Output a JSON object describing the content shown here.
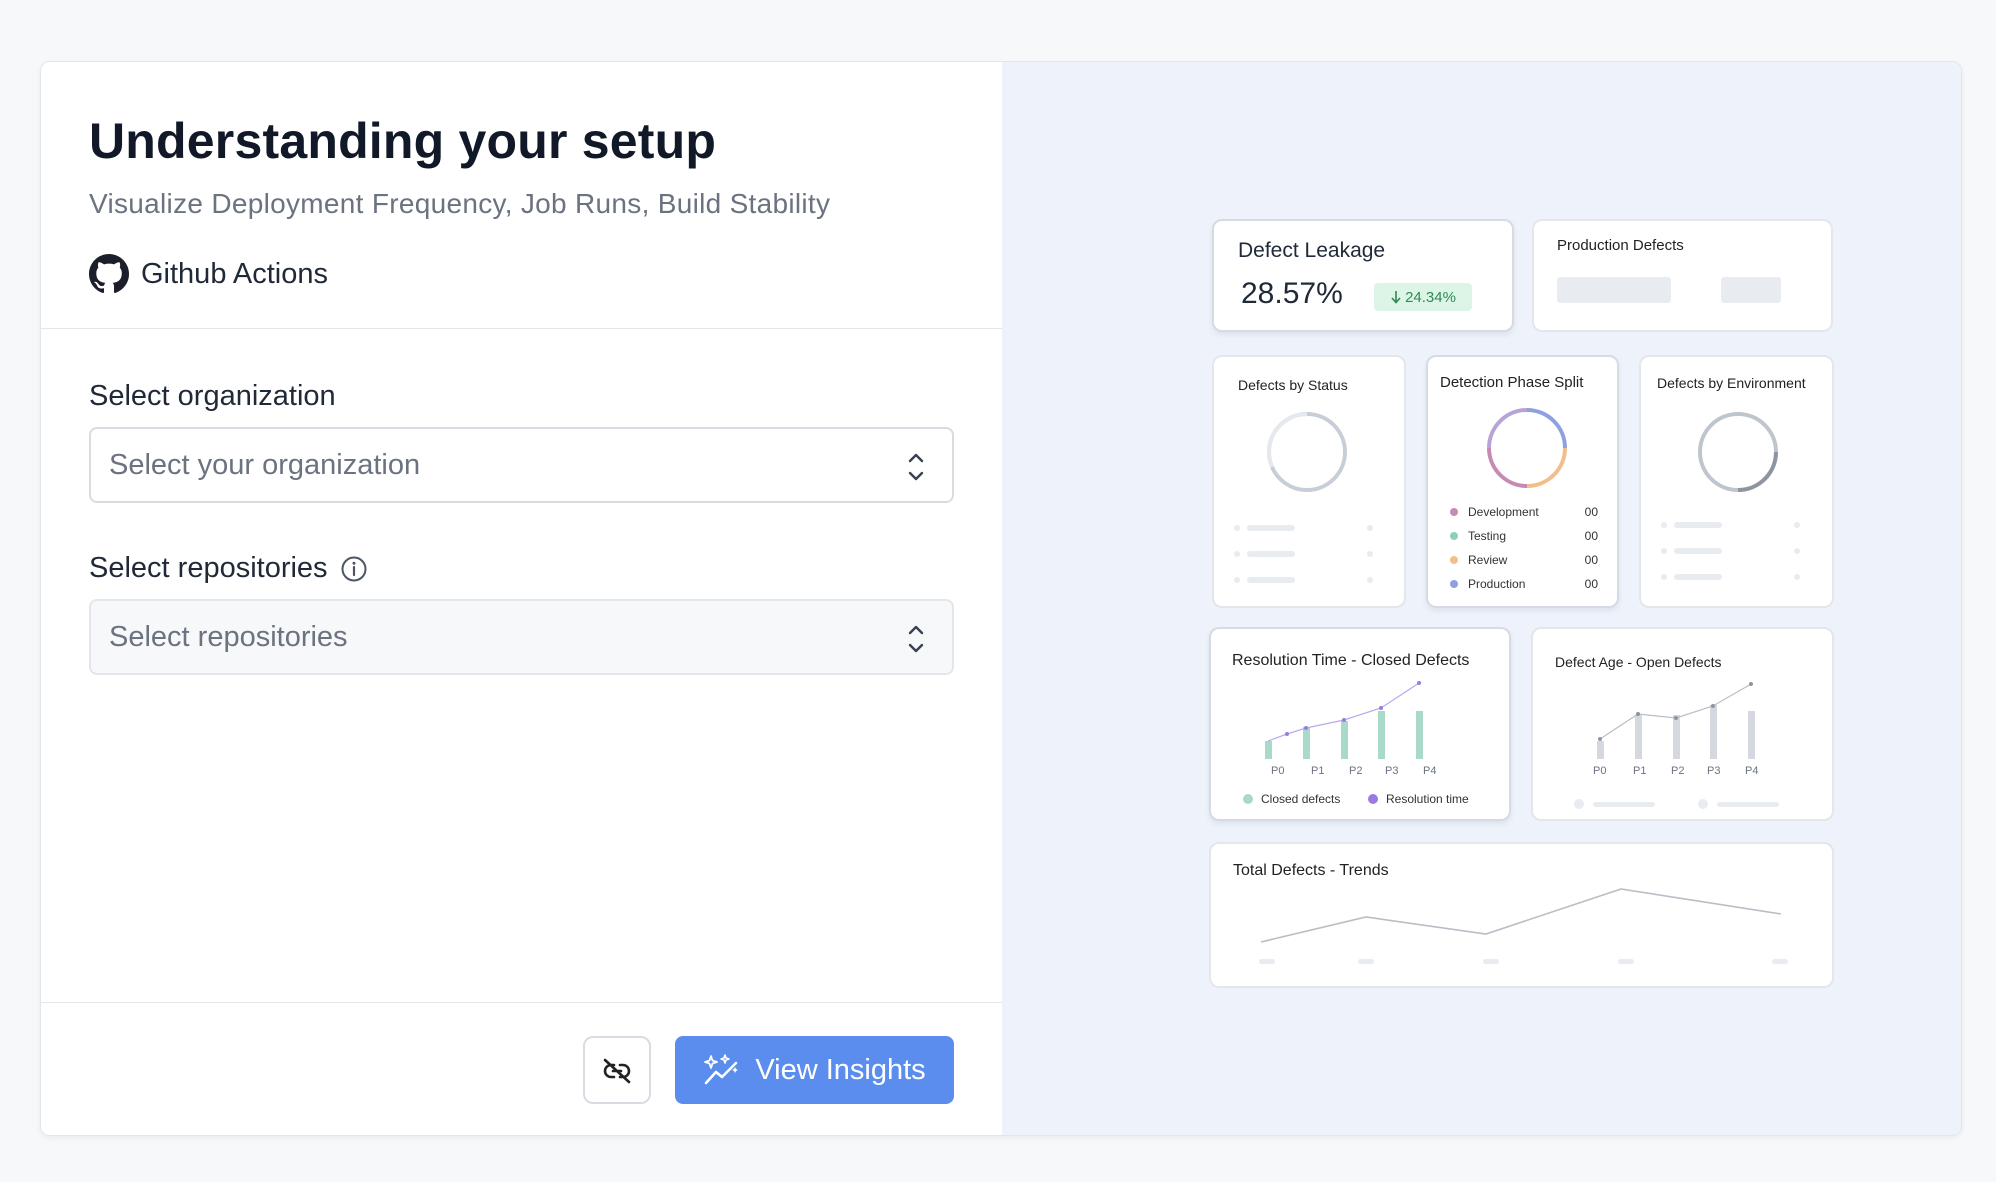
{
  "header": {
    "title": "Understanding your setup",
    "subtitle": "Visualize Deployment Frequency, Job Runs, Build Stability",
    "provider": "Github Actions"
  },
  "form": {
    "org_label": "Select organization",
    "org_placeholder": "Select your organization",
    "repo_label": "Select repositories",
    "repo_placeholder": "Select repositories"
  },
  "footer": {
    "view_insights_label": "View Insights"
  },
  "preview": {
    "defect_leakage": {
      "title": "Defect Leakage",
      "value": "28.57%",
      "delta": "24.34%"
    },
    "production_defects": {
      "title": "Production Defects"
    },
    "defects_by_status": {
      "title": "Defects by Status"
    },
    "detection_phase": {
      "title": "Detection Phase Split",
      "items": [
        {
          "label": "Development",
          "value": "00",
          "color": "#c78bb3"
        },
        {
          "label": "Testing",
          "value": "00",
          "color": "#8fcfb8"
        },
        {
          "label": "Review",
          "value": "00",
          "color": "#f2bf8a"
        },
        {
          "label": "Production",
          "value": "00",
          "color": "#8fa0e0"
        }
      ]
    },
    "defects_by_env": {
      "title": "Defects by Environment"
    },
    "resolution_time": {
      "title": "Resolution Time - Closed Defects",
      "categories": [
        "P0",
        "P1",
        "P2",
        "P3",
        "P4"
      ],
      "legend": [
        "Closed defects",
        "Resolution time"
      ]
    },
    "defect_age": {
      "title": "Defect Age - Open Defects",
      "categories": [
        "P0",
        "P1",
        "P2",
        "P3",
        "P4"
      ]
    },
    "total_trends": {
      "title": "Total Defects - Trends"
    }
  },
  "colors": {
    "accent": "#5b8def",
    "bar_green": "#a9d9c8",
    "line_purple": "#9b7be0",
    "panel_bg": "#eef3fb"
  }
}
